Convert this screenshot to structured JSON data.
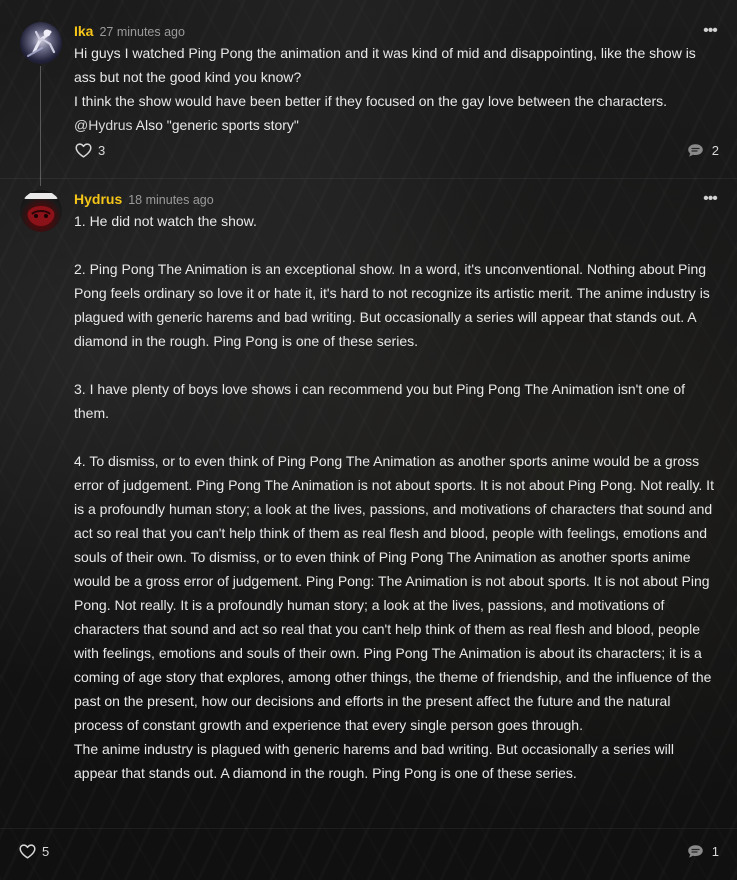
{
  "posts": [
    {
      "username": "Ika",
      "timestamp": "27 minutes ago",
      "lines": [
        "Hi guys I watched Ping Pong the animation and it was kind of mid and disappointing, like the show is ass but not the good kind you know?",
        "I think the show would have been better if they focused on the gay love between the characters."
      ],
      "mention": "@Hydrus",
      "mention_text": " Also \"generic sports story\"",
      "likes": "3",
      "replies": "2",
      "more_label": "•••",
      "avatar_icon": "avatar-skater-icon"
    },
    {
      "username": "Hydrus",
      "timestamp": "18 minutes ago",
      "paragraphs": [
        "1. He did not watch the show.",
        "2. Ping Pong The Animation is an exceptional show. In a word, it's unconventional. Nothing about Ping Pong feels ordinary so love it or hate it, it's hard to not recognize its artistic merit. The anime industry is plagued with generic harems and bad writing. But occasionally a series will appear that stands out. A diamond in the rough. Ping Pong is one of these series.",
        "3. I have plenty of boys love shows i can recommend you but Ping Pong The Animation isn't one of them.",
        "4. To dismiss, or to even think of Ping Pong The Animation as another sports anime would be a gross error of judgement. Ping Pong The Animation is not about sports. It is not about Ping Pong. Not really. It is a profoundly human story; a look at the lives, passions, and motivations of characters that sound and act so real that you can't help think of them as real flesh and blood, people with feelings, emotions and souls of their own. To dismiss, or to even think of Ping Pong The Animation as another sports anime would be a gross error of judgement. Ping Pong: The Animation is not about sports. It is not about Ping Pong. Not really. It is a profoundly human story; a look at the lives, passions, and motivations of characters that sound and act so real that you can't help think of them as real flesh and blood, people with feelings, emotions and souls of their own. Ping Pong The Animation is about its characters; it is a coming of age story that explores, among other things, the theme of friendship, and the influence of the past on the present, how our decisions and efforts in the present affect the future and the natural process of constant growth and experience that every single person goes through.",
        "The anime industry is plagued with generic harems and bad writing. But occasionally a series will appear that stands out. A diamond in the rough. Ping Pong is one of these series."
      ],
      "likes": "5",
      "replies": "1",
      "more_label": "•••",
      "avatar_icon": "avatar-dark-figure-icon"
    }
  ],
  "colors": {
    "username": "#f5c518",
    "timestamp": "#9a9a9a",
    "text": "#e8e8e8",
    "background": "#161616"
  },
  "icons": {
    "like": "heart-outline-icon",
    "replies": "speech-bubble-icon",
    "more": "more-horizontal-icon"
  }
}
